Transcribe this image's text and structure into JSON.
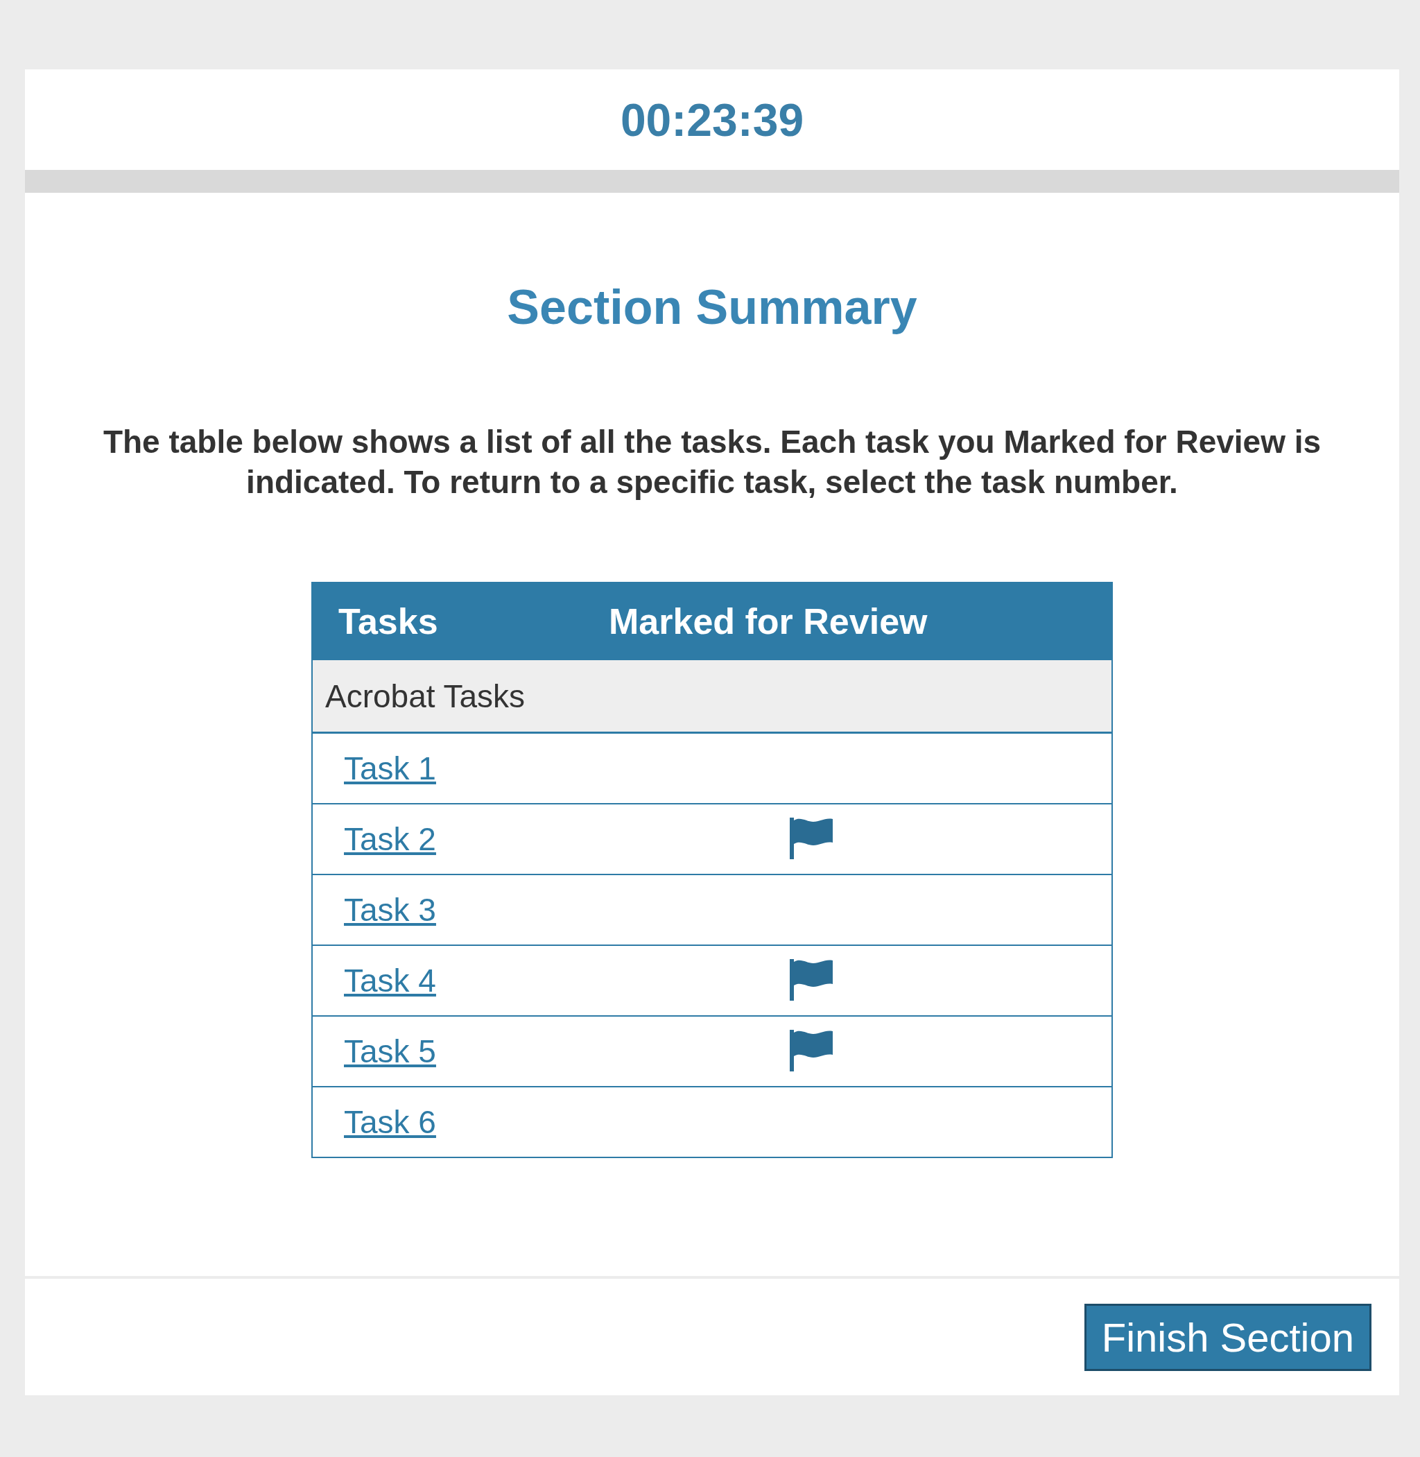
{
  "timer": "00:23:39",
  "title": "Section Summary",
  "instructions": "The table below shows a list of all the tasks. Each task you Marked for Review is indicated. To return to a specific task, select the task number.",
  "table": {
    "columns": [
      "Tasks",
      "Marked for Review"
    ],
    "groups": [
      {
        "label": "Acrobat Tasks",
        "rows": [
          {
            "task": "Task 1",
            "marked": false
          },
          {
            "task": "Task 2",
            "marked": true
          },
          {
            "task": "Task 3",
            "marked": false
          },
          {
            "task": "Task 4",
            "marked": true
          },
          {
            "task": "Task 5",
            "marked": true
          },
          {
            "task": "Task 6",
            "marked": false
          }
        ]
      }
    ]
  },
  "finish_button": "Finish Section"
}
